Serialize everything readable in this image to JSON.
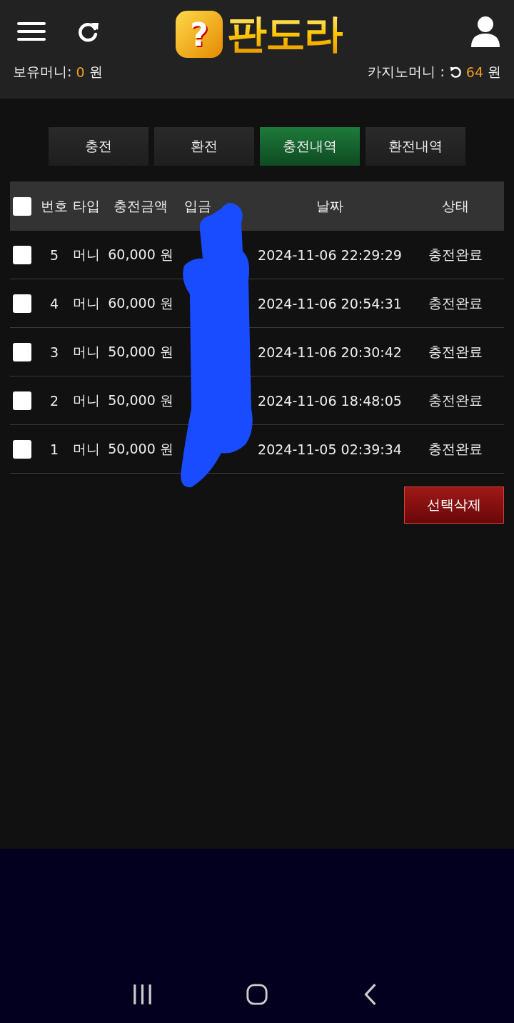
{
  "header": {
    "logo_mark": "?",
    "logo_text": "판도라"
  },
  "balances": {
    "holding_label": "보유머니:",
    "holding_value": "0",
    "holding_unit": "원",
    "casino_label": "카지노머니 :",
    "casino_value": "64",
    "casino_unit": "원"
  },
  "tabs": [
    {
      "label": "충전",
      "selected": false
    },
    {
      "label": "환전",
      "selected": false
    },
    {
      "label": "충전내역",
      "selected": true
    },
    {
      "label": "환전내역",
      "selected": false
    }
  ],
  "table": {
    "select_all": {
      "checked": false
    },
    "columns": [
      "번호",
      "타입",
      "충전금액",
      "입금",
      "날짜",
      "상태"
    ],
    "rows": [
      {
        "checked": false,
        "cells": [
          "5",
          "머니",
          "60,000 원",
          "",
          "2024-11-06 22:29:29",
          "충전완료"
        ]
      },
      {
        "checked": false,
        "cells": [
          "4",
          "머니",
          "60,000 원",
          "",
          "2024-11-06 20:54:31",
          "충전완료"
        ]
      },
      {
        "checked": false,
        "cells": [
          "3",
          "머니",
          "50,000 원",
          "",
          "2024-11-06 20:30:42",
          "충전완료"
        ]
      },
      {
        "checked": false,
        "cells": [
          "2",
          "머니",
          "50,000 원",
          "",
          "2024-11-06 18:48:05",
          "충전완료"
        ]
      },
      {
        "checked": false,
        "cells": [
          "1",
          "머니",
          "50,000 원",
          "",
          "2024-11-05 02:39:34",
          "충전완료"
        ]
      }
    ]
  },
  "delete_button": "선택삭제"
}
